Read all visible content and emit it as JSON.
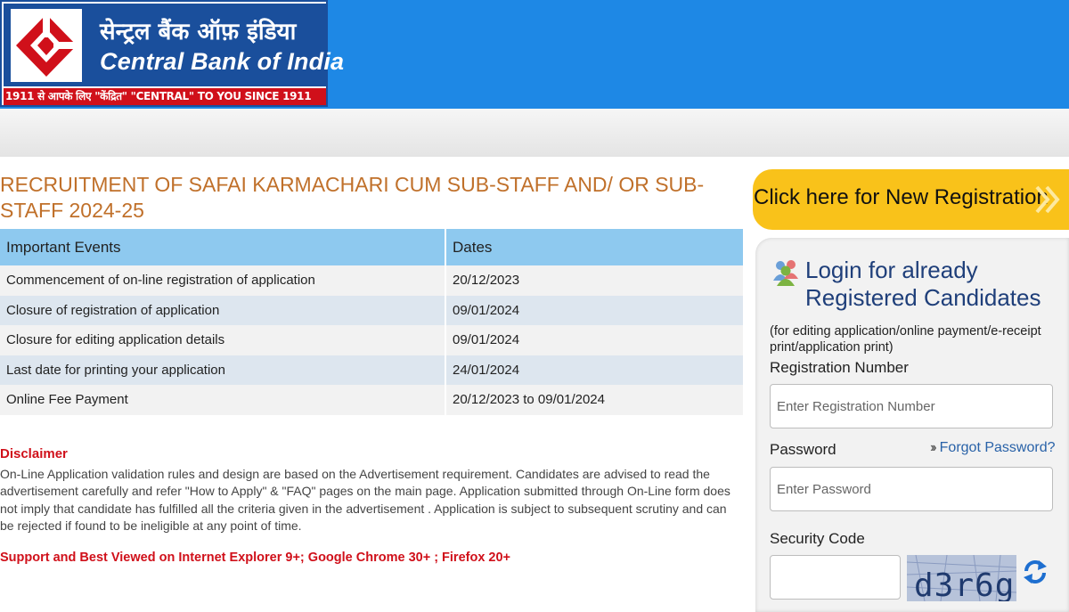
{
  "header": {
    "bank_name_hindi": "सेन्ट्रल बैंक ऑफ़ इंडिया",
    "bank_name_english": "Central Bank of India",
    "tagline": "1911 से आपके लिए \"केंद्रित\"  \"CENTRAL\" TO YOU SINCE 1911"
  },
  "page": {
    "title": "RECRUITMENT OF SAFAI KARMACHARI CUM SUB-STAFF AND/ OR SUB-STAFF 2024-25"
  },
  "events_table": {
    "headers": [
      "Important Events",
      "Dates"
    ],
    "rows": [
      {
        "event": "Commencement of on-line registration of application",
        "date": "20/12/2023"
      },
      {
        "event": "Closure of registration of application",
        "date": "09/01/2024"
      },
      {
        "event": "Closure for editing application details",
        "date": "09/01/2024"
      },
      {
        "event": "Last date for printing your application",
        "date": "24/01/2024"
      },
      {
        "event": "Online Fee Payment",
        "date": "20/12/2023 to 09/01/2024"
      }
    ]
  },
  "disclaimer": {
    "title": "Disclaimer",
    "text": "On-Line Application validation rules and design are based on the Advertisement requirement. Candidates are advised to read the advertisement carefully and refer \"How to Apply\" & \"FAQ\" pages on the main page. Application submitted through On-Line form does not imply that candidate has fulfilled all the criteria given in the advertisement . Application is subject to subsequent scrutiny and can be rejected if found to be ineligible at any point of time.",
    "support": "Support and Best Viewed on Internet Explorer 9+; Google Chrome 30+ ; Firefox 20+"
  },
  "registration": {
    "button_label": "Click here for New Registration"
  },
  "login": {
    "title": "Login for already Registered Candidates",
    "subtitle": "(for editing application/online payment/e-receipt print/application print)",
    "registration_label": "Registration Number",
    "registration_placeholder": "Enter Registration Number",
    "password_label": "Password",
    "password_placeholder": "Enter Password",
    "forgot_label": "Forgot Password?",
    "security_label": "Security Code",
    "captcha_text": "d3r6g"
  },
  "colors": {
    "header_blue": "#1e88e5",
    "logo_blue": "#1a4f9c",
    "brand_red": "#d0101a",
    "title_orange": "#c0702a",
    "button_yellow": "#f9c21a",
    "table_header": "#8ec9ef"
  }
}
